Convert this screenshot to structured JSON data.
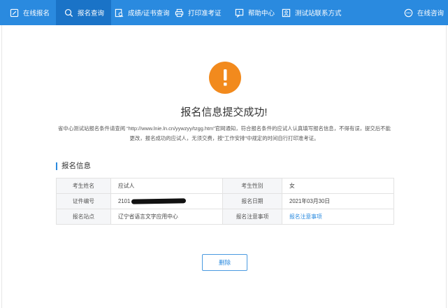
{
  "nav": {
    "items": [
      {
        "label": "在线报名",
        "icon": "edit-icon"
      },
      {
        "label": "报名查询",
        "icon": "search-icon",
        "active": true
      },
      {
        "label": "成绩/证书查询",
        "icon": "certificate-search-icon"
      },
      {
        "label": "打印准考证",
        "icon": "printer-icon"
      },
      {
        "label": "帮助中心",
        "icon": "help-icon"
      },
      {
        "label": "测试站联系方式",
        "icon": "contact-icon"
      },
      {
        "label": "在线咨询",
        "icon": "chat-icon"
      }
    ]
  },
  "result": {
    "icon": "warning-icon",
    "title": "报名信息提交成功!",
    "notice": "省中心测试站报名条件请查阅 “http://www.lnie.ln.cn/yywzyy/tzgg.htm”官网通知，符合报名条件的应试人认真填写报名信息，不得有误，提交后不能更改，报名成功的应试人，无须交费，按“工作安排”中规定的时间自行打印准考证。"
  },
  "info": {
    "section_title": "报名信息",
    "rows": [
      {
        "label1": "考生姓名",
        "value1": "应试人",
        "label2": "考生性别",
        "value2": "女"
      },
      {
        "label1": "证件编号",
        "value1": "2101",
        "label2": "报名日期",
        "value2": "2021年03月30日"
      },
      {
        "label1": "报名站点",
        "value1": "辽宁省语言文字应用中心",
        "label2": "报名注意事项",
        "value2": "报名注意事项"
      }
    ]
  },
  "actions": {
    "delete_label": "删除"
  },
  "colors": {
    "nav_bg": "#2a8adf",
    "nav_active": "#1a73c7",
    "warning": "#f28a1d",
    "link": "#2a8adf"
  }
}
